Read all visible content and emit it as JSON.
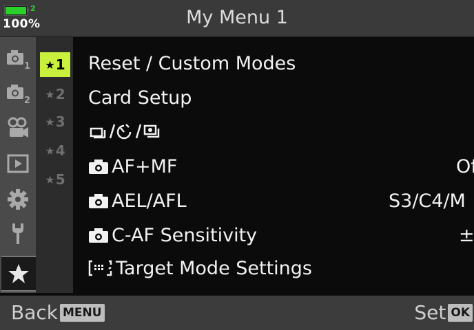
{
  "status": {
    "battery_count": "2",
    "battery_percent": "100%",
    "battery_level": 1.0,
    "battery_color": "#2bd12b"
  },
  "header": {
    "title": "My Menu 1"
  },
  "sidebar": {
    "items": [
      {
        "name": "shooting-menu-1",
        "icon": "camera-1-icon",
        "sub": "1"
      },
      {
        "name": "shooting-menu-2",
        "icon": "camera-2-icon",
        "sub": "2"
      },
      {
        "name": "video-menu",
        "icon": "video-camera-icon"
      },
      {
        "name": "playback-menu",
        "icon": "playback-icon"
      },
      {
        "name": "custom-menu",
        "icon": "gear-icon"
      },
      {
        "name": "setup-menu",
        "icon": "wrench-icon"
      },
      {
        "name": "my-menu",
        "icon": "star-icon",
        "selected": true
      }
    ]
  },
  "subtabs": [
    {
      "star": "★",
      "num": "1",
      "selected": true
    },
    {
      "star": "★",
      "num": "2"
    },
    {
      "star": "★",
      "num": "3"
    },
    {
      "star": "★",
      "num": "4"
    },
    {
      "star": "★",
      "num": "5"
    }
  ],
  "menu": {
    "items": [
      {
        "label": "Reset / Custom Modes",
        "value": ""
      },
      {
        "label": "Card Setup",
        "value": ""
      },
      {
        "label": "/  /",
        "icons": [
          "drive-sequential-icon",
          "self-timer-icon",
          "anti-shock-icon"
        ],
        "value": ""
      },
      {
        "label": "AF+MF",
        "prefix_icon": "camera-icon",
        "value": "Of"
      },
      {
        "label": "AEL/AFL",
        "prefix_icon": "camera-icon",
        "value": "S3/C4/M"
      },
      {
        "label": "C-AF Sensitivity",
        "prefix_icon": "camera-icon",
        "value": "±("
      },
      {
        "label": "Target Mode Settings",
        "prefix_icon": "af-target-icon",
        "prefix_text": "[⋯]",
        "value": ""
      }
    ]
  },
  "footer": {
    "back_label": "Back",
    "back_key": "MENU",
    "set_label": "Set",
    "set_key": "OK"
  },
  "colors": {
    "accent": "#c8f03c",
    "header_bg": "#3a3a3a",
    "sidebar_bg": "#4a4a4a",
    "background": "#0b0b0b"
  }
}
